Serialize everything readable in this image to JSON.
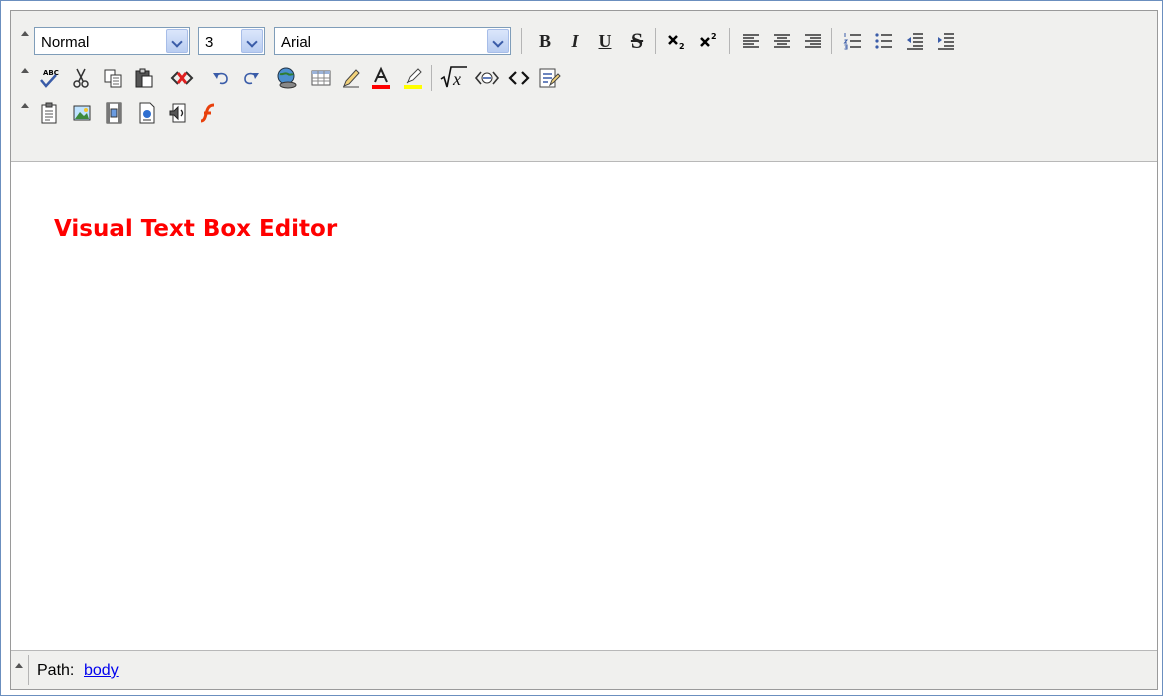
{
  "toolbar": {
    "format_select": {
      "value": "Normal"
    },
    "size_select": {
      "value": "3"
    },
    "font_select": {
      "value": "Arial"
    },
    "bold_glyph": "B",
    "italic_glyph": "I",
    "underline_glyph": "U",
    "strike_glyph": "S",
    "text_color": "#ff0000",
    "highlight_color": "#ffff00",
    "icons": [
      "spellcheck-icon",
      "cut-icon",
      "copy-icon",
      "paste-icon",
      "remove-format-icon",
      "undo-icon",
      "redo-icon",
      "insert-link-icon",
      "insert-table-icon",
      "edit-icon",
      "font-color-icon",
      "highlight-icon",
      "math-formula-icon",
      "special-char-icon",
      "source-code-icon",
      "form-icon",
      "paste-text-icon",
      "insert-image-icon",
      "insert-media-icon",
      "insert-document-icon",
      "insert-audio-icon",
      "insert-flash-icon"
    ]
  },
  "content": {
    "heading": "Visual Text Box Editor",
    "heading_color": "#ff0000"
  },
  "statusbar": {
    "path_label": "Path:",
    "path_link": "body"
  }
}
